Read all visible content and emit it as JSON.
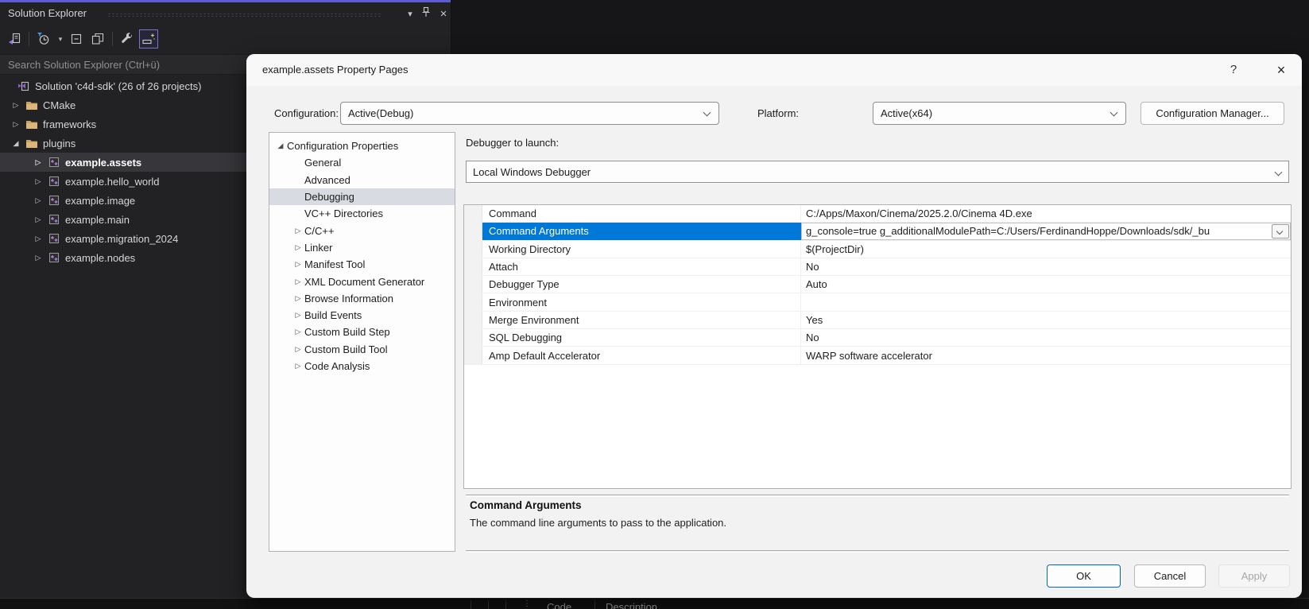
{
  "glyphs": {
    "collapsed": "▷",
    "expanded": "◢",
    "caret": "▾",
    "close": "×",
    "help": "?",
    "grip": "⋮"
  },
  "colors": {
    "accent": "#5d5bd6",
    "grid_selection": "#0078d7",
    "tree_selection_light": "#d8dbe2",
    "tree_selection_dark": "#37373b",
    "folder": "#dcb67a",
    "project_purple": "#b57edc"
  },
  "solution_explorer": {
    "title": "Solution Explorer",
    "search_placeholder": "Search Solution Explorer (Ctrl+ü)",
    "tree": [
      {
        "label": "Solution 'c4d-sdk' (26 of 26 projects)"
      },
      {
        "label": "CMake"
      },
      {
        "label": "frameworks"
      },
      {
        "label": "plugins"
      },
      {
        "label": "example.assets"
      },
      {
        "label": "example.hello_world"
      },
      {
        "label": "example.image"
      },
      {
        "label": "example.main"
      },
      {
        "label": "example.migration_2024"
      },
      {
        "label": "example.nodes"
      }
    ]
  },
  "dialog": {
    "title": "example.assets Property Pages",
    "configuration_label": "Configuration:",
    "configuration_value": "Active(Debug)",
    "platform_label": "Platform:",
    "platform_value": "Active(x64)",
    "config_manager_button": "Configuration Manager...",
    "tree": [
      {
        "label": "Configuration Properties"
      },
      {
        "label": "General"
      },
      {
        "label": "Advanced"
      },
      {
        "label": "Debugging"
      },
      {
        "label": "VC++ Directories"
      },
      {
        "label": "C/C++"
      },
      {
        "label": "Linker"
      },
      {
        "label": "Manifest Tool"
      },
      {
        "label": "XML Document Generator"
      },
      {
        "label": "Browse Information"
      },
      {
        "label": "Build Events"
      },
      {
        "label": "Custom Build Step"
      },
      {
        "label": "Custom Build Tool"
      },
      {
        "label": "Code Analysis"
      }
    ],
    "debugger_label": "Debugger to launch:",
    "debugger_value": "Local Windows Debugger",
    "grid": {
      "rows": [
        {
          "label": "Command",
          "value": "C:/Apps/Maxon/Cinema/2025.2.0/Cinema 4D.exe"
        },
        {
          "label": "Command Arguments",
          "value": "g_console=true g_additionalModulePath=C:/Users/FerdinandHoppe/Downloads/sdk/_bu"
        },
        {
          "label": "Working Directory",
          "value": "$(ProjectDir)"
        },
        {
          "label": "Attach",
          "value": "No"
        },
        {
          "label": "Debugger Type",
          "value": "Auto"
        },
        {
          "label": "Environment",
          "value": ""
        },
        {
          "label": "Merge Environment",
          "value": "Yes"
        },
        {
          "label": "SQL Debugging",
          "value": "No"
        },
        {
          "label": "Amp Default Accelerator",
          "value": "WARP software accelerator"
        }
      ]
    },
    "description": {
      "title": "Command Arguments",
      "text": "The command line arguments to pass to the application."
    },
    "buttons": {
      "ok": "OK",
      "cancel": "Cancel",
      "apply": "Apply"
    }
  },
  "error_list": {
    "columns": [
      "Code",
      "Description"
    ]
  }
}
